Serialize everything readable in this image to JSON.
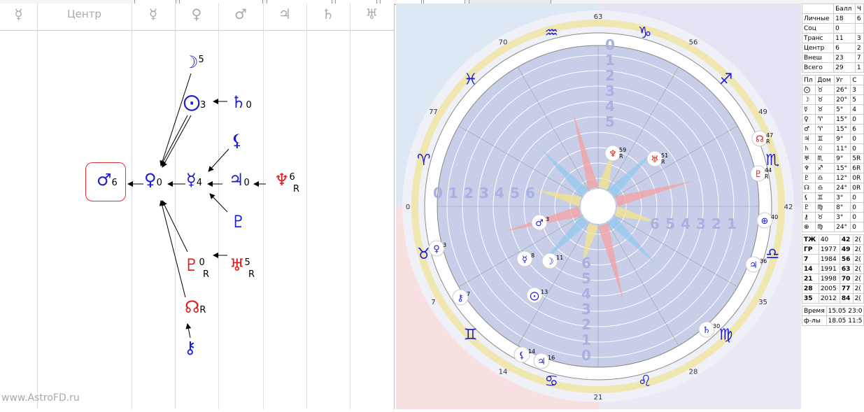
{
  "left_panel": {
    "header_center": "Центр",
    "header_glyphs": [
      "☿",
      "☿",
      "♀",
      "♂",
      "♃",
      "♄",
      "♅"
    ],
    "watermark": "www.AstroFD.ru",
    "nodes": {
      "mars": {
        "glyph": "♂",
        "num": "6"
      },
      "venus": {
        "glyph": "♀",
        "num": "0"
      },
      "mercury": {
        "glyph": "☿",
        "num": "4"
      },
      "jupiter": {
        "glyph": "♃",
        "num": "0"
      },
      "neptune": {
        "glyph": "♆",
        "num": "6",
        "sub": "R"
      },
      "moon": {
        "glyph": "☽",
        "num": "5"
      },
      "sun": {
        "glyph": "⨀",
        "num": "3"
      },
      "saturn": {
        "glyph": "♄",
        "num": "0"
      },
      "lilith": {
        "glyph": "⚸",
        "num": ""
      },
      "proserpina": {
        "glyph": "♇",
        "num": ""
      },
      "pluto": {
        "glyph": "♇",
        "num": "0",
        "sub": "R"
      },
      "uranus": {
        "glyph": "♅",
        "num": "5",
        "sub": "R"
      },
      "node": {
        "glyph": "☊",
        "num": "",
        "sub": "R"
      },
      "chiron": {
        "glyph": "⚷",
        "num": ""
      }
    }
  },
  "wheel": {
    "degree_labels": [
      "63",
      "56",
      "49",
      "42",
      "35",
      "28",
      "21",
      "14",
      "7",
      "0",
      "77",
      "70"
    ],
    "signs": [
      "♑",
      "♐",
      "♏",
      "♎",
      "♍",
      "♌",
      "♋",
      "♊",
      "♉",
      "♈",
      "♓",
      "♒"
    ],
    "ring_numbers_left": [
      "0",
      "1",
      "2",
      "3",
      "4",
      "5",
      "6"
    ],
    "ring_numbers_right": [
      "6",
      "5",
      "4",
      "3",
      "2",
      "1"
    ],
    "ring_numbers_top": [
      "0",
      "1",
      "2",
      "3",
      "4",
      "5"
    ],
    "ring_numbers_bottom": [
      "6",
      "5",
      "4",
      "3",
      "2",
      "1",
      "0"
    ],
    "planets": [
      {
        "glyph": "♆",
        "label": "59",
        "sub": "R"
      },
      {
        "glyph": "♅",
        "label": "51",
        "sub": "R"
      },
      {
        "glyph": "☊",
        "label": "47",
        "sub": "R"
      },
      {
        "glyph": "♇",
        "label": "44",
        "sub": "R"
      },
      {
        "glyph": "⊕",
        "label": "40"
      },
      {
        "glyph": "♃",
        "label": "36"
      },
      {
        "glyph": "♄",
        "label": "30"
      },
      {
        "glyph": "♂",
        "label": "3"
      },
      {
        "glyph": "♀",
        "label": "3"
      },
      {
        "glyph": "☿",
        "label": "8"
      },
      {
        "glyph": "☽",
        "label": "11"
      },
      {
        "glyph": "⨀",
        "label": "13"
      },
      {
        "glyph": "⚷",
        "label": "7"
      },
      {
        "glyph": "⚸",
        "label": "14"
      },
      {
        "glyph": "♃",
        "label": "16"
      }
    ]
  },
  "table": {
    "header": [
      "",
      "Балл",
      "Ч"
    ],
    "score_rows": [
      [
        "Личные",
        "18",
        "6"
      ],
      [
        "Соц",
        "0",
        ""
      ],
      [
        "Транс",
        "11",
        "3"
      ],
      [
        "Центр",
        "6",
        "2"
      ],
      [
        "Внеш",
        "23",
        "7"
      ],
      [
        "Всего",
        "29",
        "1"
      ]
    ],
    "planet_header": [
      "Пл",
      "Дом",
      "Уг",
      "С"
    ],
    "planet_rows": [
      [
        "⨀",
        "♉",
        "26°",
        "3"
      ],
      [
        "☽",
        "♉",
        "20°",
        "5"
      ],
      [
        "☿",
        "♉",
        "5°",
        "4"
      ],
      [
        "♀",
        "♈",
        "15°",
        "0"
      ],
      [
        "♂",
        "♈",
        "15°",
        "6"
      ],
      [
        "♃",
        "♊",
        "9°",
        "0"
      ],
      [
        "♄",
        "♌",
        "11°",
        "0"
      ],
      [
        "♅",
        "♏",
        "9°",
        "5R"
      ],
      [
        "♆",
        "♐",
        "15°",
        "6R"
      ],
      [
        "♇",
        "♎",
        "12°",
        "0R"
      ],
      [
        "☊",
        "♎",
        "24°",
        "0R"
      ],
      [
        "⚸",
        "♊",
        "3°",
        "0"
      ],
      [
        "♇",
        "♍",
        "8°",
        "0"
      ],
      [
        "⚷",
        "♉",
        "3°",
        "0"
      ],
      [
        "⊕",
        "♍",
        "24°",
        "0"
      ]
    ],
    "age_rows": [
      [
        "ТЖ",
        "40",
        "42",
        "2("
      ],
      [
        "ГР",
        "1977",
        "49",
        "2("
      ],
      [
        "7",
        "1984",
        "56",
        "2("
      ],
      [
        "14",
        "1991",
        "63",
        "2("
      ],
      [
        "21",
        "1998",
        "70",
        "2("
      ],
      [
        "28",
        "2005",
        "77",
        "2("
      ],
      [
        "35",
        "2012",
        "84",
        "2("
      ]
    ],
    "time_label": "Время",
    "time_value": "15.05 23:0",
    "formula_label": "ф-лы",
    "formula_value": "18.05 11:5"
  }
}
